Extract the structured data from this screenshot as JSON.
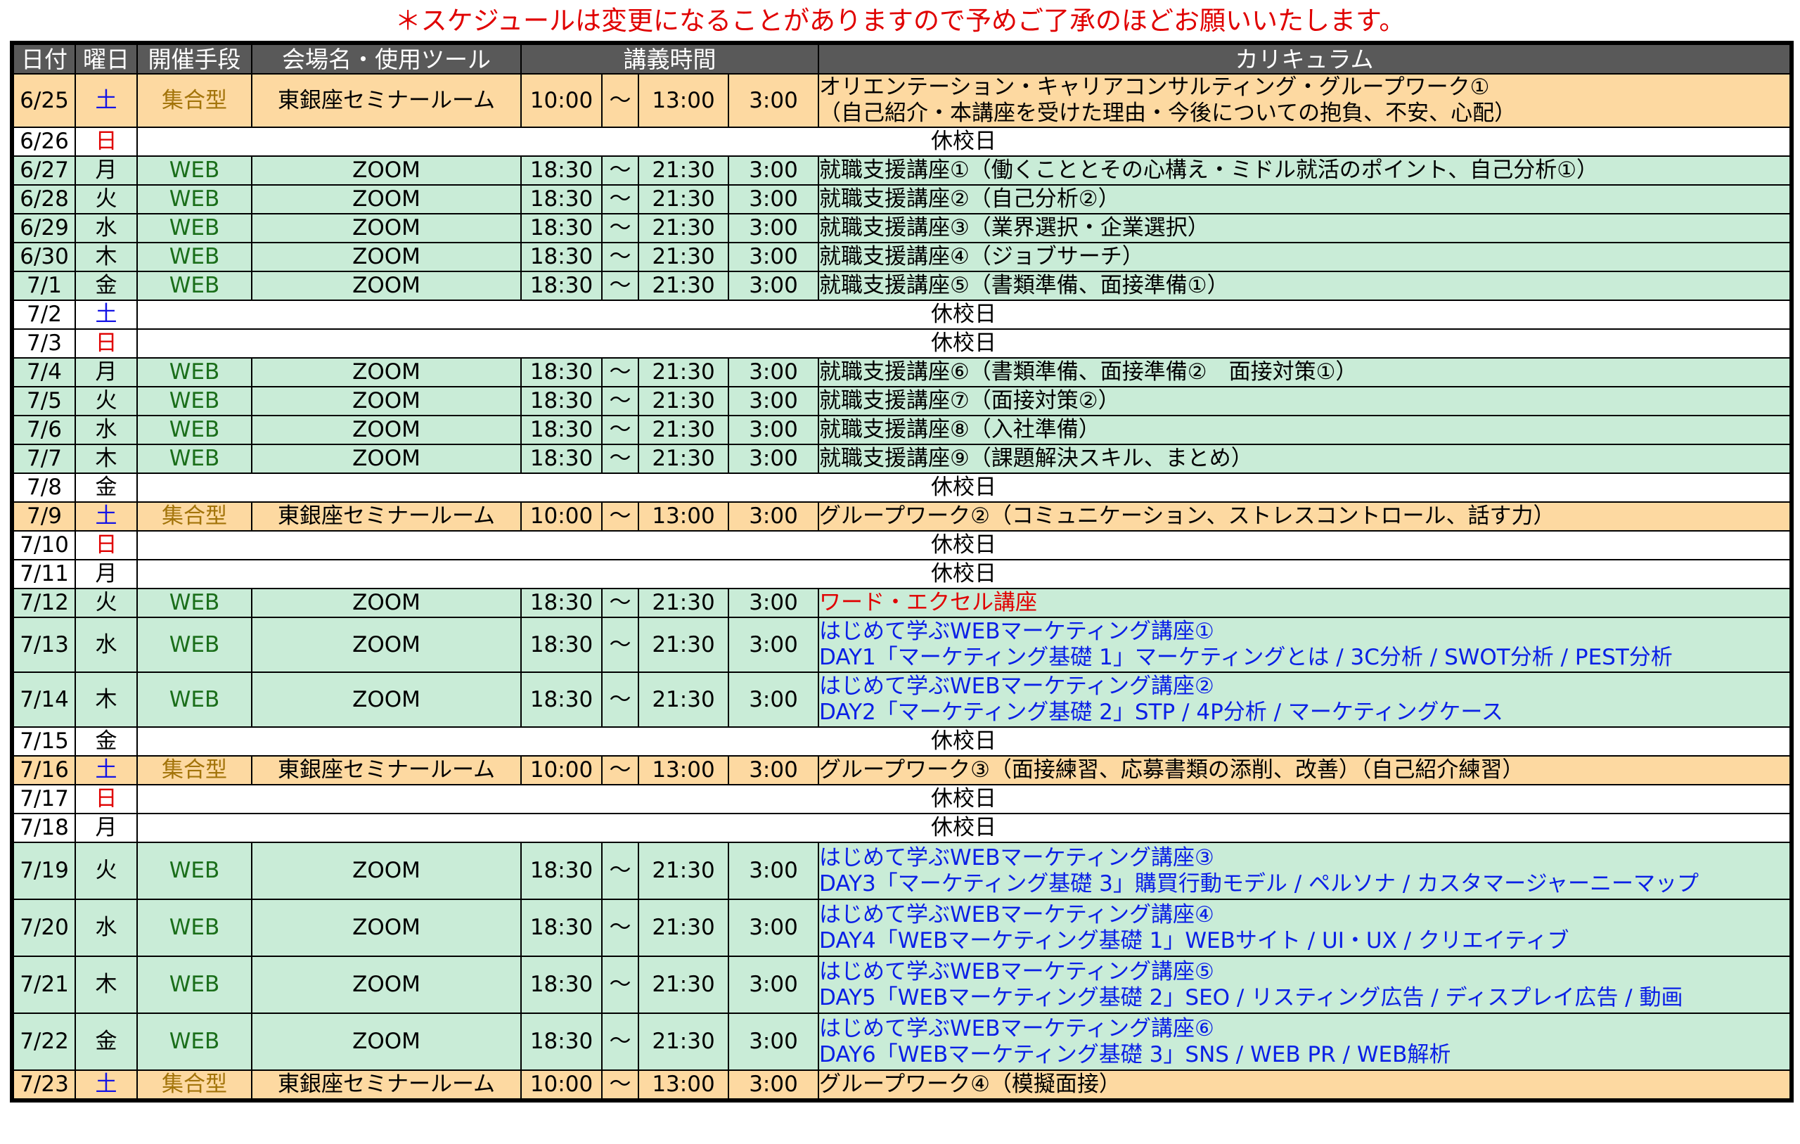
{
  "notice": "＊スケジュールは変更になることがありますので予めご了承のほどお願いいたします。",
  "headers": {
    "date": "日付",
    "weekday": "曜日",
    "mode": "開催手段",
    "venue": "会場名・使用ツール",
    "time": "講義時間",
    "curriculum": "カリキュラム"
  },
  "tilde": "～",
  "colors": {
    "header_bg": "#595959",
    "in_person_row": "#fdd9a1",
    "web_row": "#c9ecd7",
    "notice_red": "#e00000",
    "saturday_blue": "#1414e6",
    "sunday_red": "#e00000",
    "web_text_green": "#1a6e1a",
    "in_person_text": "#a3740a",
    "link_blue": "#0a20e6"
  },
  "rows": [
    {
      "date": "6/25",
      "weekday": "土",
      "type": "meet",
      "mode": "集合型",
      "venue": "東銀座セミナールーム",
      "start": "10:00",
      "end": "13:00",
      "duration": "3:00",
      "lines": [
        "オリエンテーション・キャリアコンサルティング・グループワーク①",
        "（自己紹介・本講座を受けた理由・今後についての抱負、不安、心配）"
      ],
      "style": "black"
    },
    {
      "date": "6/26",
      "weekday": "日",
      "type": "off",
      "text": "休校日"
    },
    {
      "date": "6/27",
      "weekday": "月",
      "type": "web",
      "mode": "WEB",
      "venue": "ZOOM",
      "start": "18:30",
      "end": "21:30",
      "duration": "3:00",
      "lines": [
        "就職支援講座①（働くこととその心構え・ミドル就活のポイント、自己分析①）"
      ],
      "style": "black"
    },
    {
      "date": "6/28",
      "weekday": "火",
      "type": "web",
      "mode": "WEB",
      "venue": "ZOOM",
      "start": "18:30",
      "end": "21:30",
      "duration": "3:00",
      "lines": [
        "就職支援講座②（自己分析②）"
      ],
      "style": "black"
    },
    {
      "date": "6/29",
      "weekday": "水",
      "type": "web",
      "mode": "WEB",
      "venue": "ZOOM",
      "start": "18:30",
      "end": "21:30",
      "duration": "3:00",
      "lines": [
        "就職支援講座③（業界選択・企業選択）"
      ],
      "style": "black"
    },
    {
      "date": "6/30",
      "weekday": "木",
      "type": "web",
      "mode": "WEB",
      "venue": "ZOOM",
      "start": "18:30",
      "end": "21:30",
      "duration": "3:00",
      "lines": [
        "就職支援講座④（ジョブサーチ）"
      ],
      "style": "black"
    },
    {
      "date": "7/1",
      "weekday": "金",
      "type": "web",
      "mode": "WEB",
      "venue": "ZOOM",
      "start": "18:30",
      "end": "21:30",
      "duration": "3:00",
      "lines": [
        "就職支援講座⑤（書類準備、面接準備①）"
      ],
      "style": "black"
    },
    {
      "date": "7/2",
      "weekday": "土",
      "type": "off",
      "text": "休校日"
    },
    {
      "date": "7/3",
      "weekday": "日",
      "type": "off",
      "text": "休校日"
    },
    {
      "date": "7/4",
      "weekday": "月",
      "type": "web",
      "mode": "WEB",
      "venue": "ZOOM",
      "start": "18:30",
      "end": "21:30",
      "duration": "3:00",
      "lines": [
        "就職支援講座⑥（書類準備、面接準備②　面接対策①）"
      ],
      "style": "black"
    },
    {
      "date": "7/5",
      "weekday": "火",
      "type": "web",
      "mode": "WEB",
      "venue": "ZOOM",
      "start": "18:30",
      "end": "21:30",
      "duration": "3:00",
      "lines": [
        "就職支援講座⑦（面接対策②）"
      ],
      "style": "black"
    },
    {
      "date": "7/6",
      "weekday": "水",
      "type": "web",
      "mode": "WEB",
      "venue": "ZOOM",
      "start": "18:30",
      "end": "21:30",
      "duration": "3:00",
      "lines": [
        "就職支援講座⑧（入社準備）"
      ],
      "style": "black"
    },
    {
      "date": "7/7",
      "weekday": "木",
      "type": "web",
      "mode": "WEB",
      "venue": "ZOOM",
      "start": "18:30",
      "end": "21:30",
      "duration": "3:00",
      "lines": [
        "就職支援講座⑨（課題解決スキル、まとめ）"
      ],
      "style": "black"
    },
    {
      "date": "7/8",
      "weekday": "金",
      "type": "off",
      "text": "休校日"
    },
    {
      "date": "7/9",
      "weekday": "土",
      "type": "meet",
      "mode": "集合型",
      "venue": "東銀座セミナールーム",
      "start": "10:00",
      "end": "13:00",
      "duration": "3:00",
      "lines": [
        "グループワーク②（コミュニケーション、ストレスコントロール、話す力）"
      ],
      "style": "black"
    },
    {
      "date": "7/10",
      "weekday": "日",
      "type": "off",
      "text": "休校日"
    },
    {
      "date": "7/11",
      "weekday": "月",
      "type": "off",
      "text": "休校日"
    },
    {
      "date": "7/12",
      "weekday": "火",
      "type": "web",
      "mode": "WEB",
      "venue": "ZOOM",
      "start": "18:30",
      "end": "21:30",
      "duration": "3:00",
      "lines": [
        "ワード・エクセル講座"
      ],
      "style": "red"
    },
    {
      "date": "7/13",
      "weekday": "水",
      "type": "web",
      "mode": "WEB",
      "venue": "ZOOM",
      "start": "18:30",
      "end": "21:30",
      "duration": "3:00",
      "lines": [
        "はじめて学ぶWEBマーケティング講座①",
        "DAY1「マーケティング基礎 1」マーケティングとは / 3C分析 / SWOT分析 / PEST分析"
      ],
      "style": "blue"
    },
    {
      "date": "7/14",
      "weekday": "木",
      "type": "web",
      "mode": "WEB",
      "venue": "ZOOM",
      "start": "18:30",
      "end": "21:30",
      "duration": "3:00",
      "lines": [
        "はじめて学ぶWEBマーケティング講座②",
        "DAY2「マーケティング基礎 2」STP / 4P分析 / マーケティングケース"
      ],
      "style": "blue"
    },
    {
      "date": "7/15",
      "weekday": "金",
      "type": "off",
      "text": "休校日"
    },
    {
      "date": "7/16",
      "weekday": "土",
      "type": "meet",
      "mode": "集合型",
      "venue": "東銀座セミナールーム",
      "start": "10:00",
      "end": "13:00",
      "duration": "3:00",
      "lines": [
        "グループワーク③（面接練習、応募書類の添削、改善）（自己紹介練習）"
      ],
      "style": "black"
    },
    {
      "date": "7/17",
      "weekday": "日",
      "type": "off",
      "text": "休校日"
    },
    {
      "date": "7/18",
      "weekday": "月",
      "type": "off",
      "text": "休校日"
    },
    {
      "date": "7/19",
      "weekday": "火",
      "type": "web",
      "mode": "WEB",
      "venue": "ZOOM",
      "start": "18:30",
      "end": "21:30",
      "duration": "3:00",
      "lines": [
        "はじめて学ぶWEBマーケティング講座③",
        "DAY3「マーケティング基礎 3」購買行動モデル / ペルソナ / カスタマージャーニーマップ"
      ],
      "style": "blue"
    },
    {
      "date": "7/20",
      "weekday": "水",
      "type": "web",
      "mode": "WEB",
      "venue": "ZOOM",
      "start": "18:30",
      "end": "21:30",
      "duration": "3:00",
      "lines": [
        "はじめて学ぶWEBマーケティング講座④",
        "DAY4「WEBマーケティング基礎 1」WEBサイト / UI・UX / クリエイティブ"
      ],
      "style": "blue"
    },
    {
      "date": "7/21",
      "weekday": "木",
      "type": "web",
      "mode": "WEB",
      "venue": "ZOOM",
      "start": "18:30",
      "end": "21:30",
      "duration": "3:00",
      "lines": [
        "はじめて学ぶWEBマーケティング講座⑤",
        "DAY5「WEBマーケティング基礎 2」SEO / リスティング広告 / ディスプレイ広告 / 動画"
      ],
      "style": "blue"
    },
    {
      "date": "7/22",
      "weekday": "金",
      "type": "web",
      "mode": "WEB",
      "venue": "ZOOM",
      "start": "18:30",
      "end": "21:30",
      "duration": "3:00",
      "lines": [
        "はじめて学ぶWEBマーケティング講座⑥",
        "DAY6「WEBマーケティング基礎 3」SNS / WEB PR / WEB解析"
      ],
      "style": "blue"
    },
    {
      "date": "7/23",
      "weekday": "土",
      "type": "meet",
      "mode": "集合型",
      "venue": "東銀座セミナールーム",
      "start": "10:00",
      "end": "13:00",
      "duration": "3:00",
      "lines": [
        "グループワーク④（模擬面接）"
      ],
      "style": "black"
    }
  ]
}
